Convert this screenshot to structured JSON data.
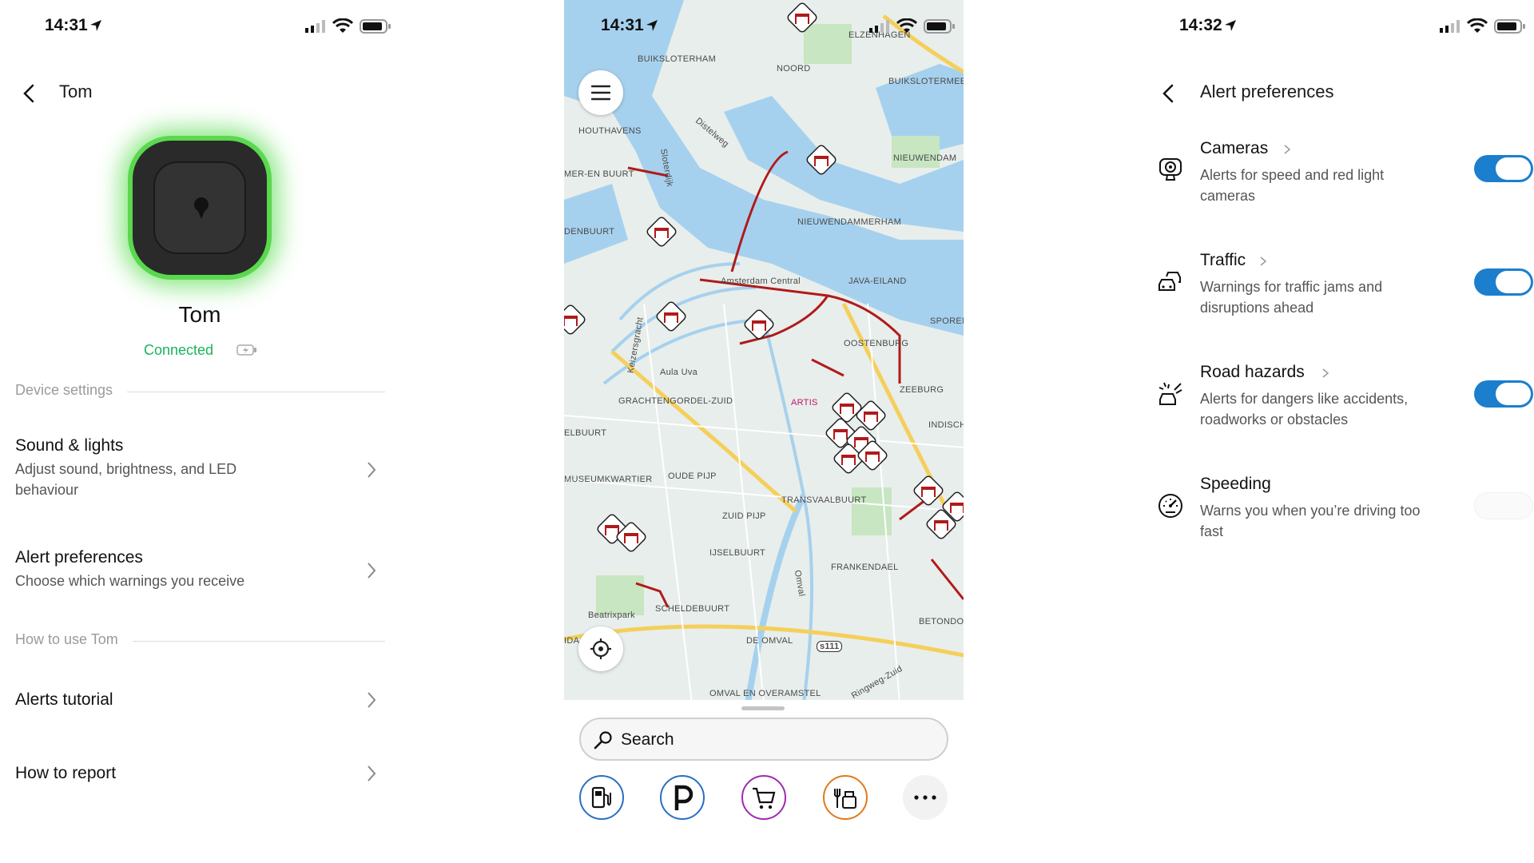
{
  "left": {
    "status": {
      "time": "14:31"
    },
    "header": {
      "title": "Tom"
    },
    "device": {
      "name": "Tom",
      "status": "Connected"
    },
    "sections": {
      "device_settings": "Device settings",
      "how_to": "How to use Tom"
    },
    "rows": [
      {
        "title": "Sound & lights",
        "subtitle": "Adjust sound, brightness, and LED behaviour"
      },
      {
        "title": "Alert preferences",
        "subtitle": "Choose which warnings you receive"
      },
      {
        "title": "Alerts tutorial",
        "subtitle": ""
      },
      {
        "title": "How to report",
        "subtitle": ""
      }
    ],
    "colors": {
      "connected": "#1bb25c",
      "led_glow": "#5ad84e"
    }
  },
  "middle": {
    "status": {
      "time": "14:31"
    },
    "map_labels": [
      "BUIKSLOTERHAM",
      "NOORD",
      "ELZENHAGEN",
      "BUIKSLOTERMEER",
      "HOUTHAVENS",
      "Distelweg",
      "MER-EN BUURT",
      "Sloterdijk",
      "NIEUWENDAM",
      "DENBUURT",
      "NIEUWENDAMMERHAM",
      "Amsterdam Central",
      "JAVA-EILAND",
      "SPOREN",
      "Keizersgracht",
      "OOSTENBURG",
      "Aula Uva",
      "ARTIS",
      "ZEEBURG",
      "GRACHTENGORDEL-ZUID",
      "ELBUURT",
      "INDISCH",
      "MUSEUMKWARTIER",
      "OUDE PIJP",
      "TRANSVAALBUURT",
      "ZUID PIJP",
      "IJSELBUURT",
      "FRANKENDAEL",
      "Omval",
      "Beatrixpark",
      "SCHELDEBUURT",
      "BETONDO",
      "IDA",
      "DE OMVAL",
      "s111",
      "OMVAL EN OVERAMSTEL",
      "Ringweg-Zuid"
    ],
    "search": {
      "placeholder": "Search"
    },
    "quick_actions": [
      "fuel-station-icon",
      "parking-icon",
      "shopping-cart-icon",
      "roadside-food-icon",
      "more-icon"
    ],
    "colors": {
      "water": "#a6d1ee",
      "land": "#e8eeeb",
      "traffic": "#b01a1a",
      "road": "#f5cf5a"
    }
  },
  "right": {
    "status": {
      "time": "14:32"
    },
    "header": {
      "title": "Alert preferences"
    },
    "prefs": [
      {
        "title": "Cameras",
        "subtitle": "Alerts for speed and red light cameras",
        "enabled": true,
        "icon": "speed-camera-icon"
      },
      {
        "title": "Traffic",
        "subtitle": "Warnings for traffic jams and disruptions ahead",
        "enabled": true,
        "icon": "traffic-cars-icon"
      },
      {
        "title": "Road hazards",
        "subtitle": "Alerts for dangers like accidents, roadworks or obstacles",
        "enabled": true,
        "icon": "road-hazard-icon"
      },
      {
        "title": "Speeding",
        "subtitle": "Warns you when you’re driving too fast",
        "enabled": false,
        "icon": "speedometer-icon"
      }
    ],
    "colors": {
      "toggle_on": "#1b7fce"
    }
  }
}
